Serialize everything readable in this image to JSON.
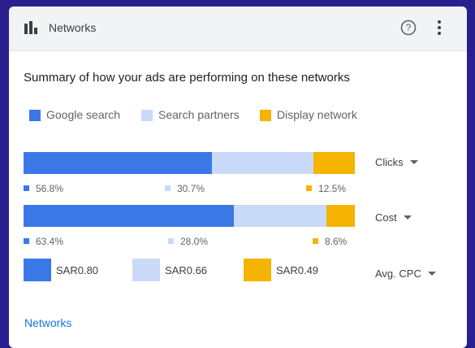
{
  "header": {
    "title": "Networks",
    "help_icon": "help-circle-icon",
    "more_icon": "more-vert-icon",
    "chart_icon": "bar-chart-icon"
  },
  "summary": "Summary of how your ads are performing on these networks",
  "legend": [
    {
      "label": "Google search",
      "color": "#3b78e7"
    },
    {
      "label": "Search partners",
      "color": "#c9daf8"
    },
    {
      "label": "Display network",
      "color": "#f4b400"
    }
  ],
  "metrics": {
    "clicks": {
      "label": "Clicks",
      "shares": [
        56.8,
        30.7,
        12.5
      ],
      "labels": [
        "56.8%",
        "30.7%",
        "12.5%"
      ]
    },
    "cost": {
      "label": "Cost",
      "shares": [
        63.4,
        28.0,
        8.6
      ],
      "labels": [
        "63.4%",
        "28.0%",
        "8.6%"
      ]
    },
    "cpc": {
      "label": "Avg. CPC",
      "values": [
        "SAR0.80",
        "SAR0.66",
        "SAR0.49"
      ]
    }
  },
  "footer": {
    "link": "Networks"
  }
}
